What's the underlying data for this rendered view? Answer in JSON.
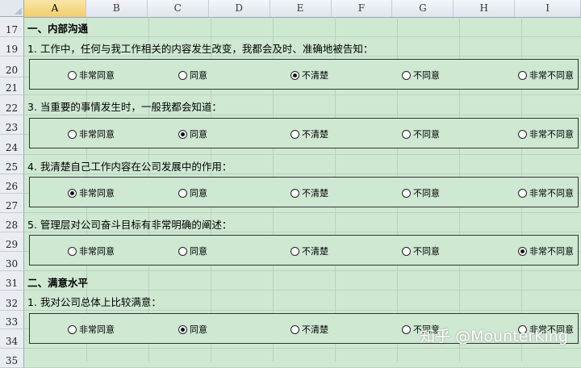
{
  "columns": [
    "A",
    "B",
    "C",
    "D",
    "E",
    "F",
    "G",
    "H",
    "I"
  ],
  "active_column": "A",
  "rows": [
    "17",
    "19",
    "20",
    "21",
    "22",
    "23",
    "24",
    "25",
    "26",
    "27",
    "28",
    "29",
    "30",
    "31",
    "32",
    "33",
    "34",
    "35"
  ],
  "options": [
    "非常同意",
    "同意",
    "不清楚",
    "不同意",
    "非常不同意"
  ],
  "sections": [
    {
      "title": "一、内部沟通",
      "questions": [
        {
          "text": "1. 工作中，任何与我工作相关的内容发生改变，我都会及时、准确地被告知：",
          "selected": 2
        },
        {
          "text": "3. 当重要的事情发生时，一般我都会知道：",
          "selected": 1
        },
        {
          "text": "4. 我清楚自己工作内容在公司发展中的作用：",
          "selected": 0
        },
        {
          "text": "5. 管理层对公司奋斗目标有非常明确的阐述：",
          "selected": 4
        }
      ]
    },
    {
      "title": "二、满意水平",
      "questions": [
        {
          "text": "1. 我对公司总体上比较满意：",
          "selected": 1
        }
      ]
    }
  ],
  "watermark": "知乎 @MounterKing",
  "colors": {
    "sheet_background": "#cfe8d2",
    "header_background": "#e3e8ef",
    "active_header": "#f1cd6b"
  }
}
